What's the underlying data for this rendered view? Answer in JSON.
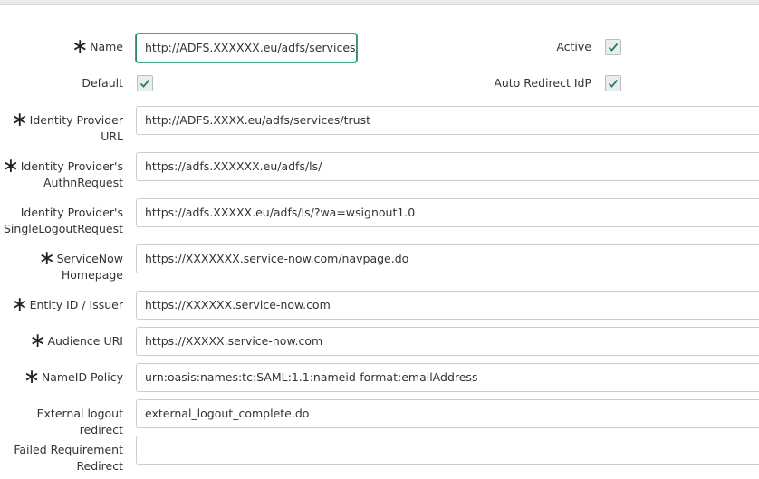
{
  "form": {
    "name": {
      "label": "Name",
      "value": "http://ADFS.XXXXXX.eu/adfs/services/trus"
    },
    "default": {
      "label": "Default",
      "checked": true
    },
    "active": {
      "label": "Active",
      "checked": true
    },
    "auto_redirect": {
      "label": "Auto Redirect IdP",
      "checked": true
    },
    "idp_url": {
      "label_line1": "Identity Provider",
      "label_line2": "URL",
      "value": "http://ADFS.XXXX.eu/adfs/services/trust"
    },
    "authn": {
      "label_line1": "Identity Provider's",
      "label_line2": "AuthnRequest",
      "value": "https://adfs.XXXXXX.eu/adfs/ls/"
    },
    "logout": {
      "label_line1": "Identity Provider's",
      "label_line2": "SingleLogoutRequest",
      "value": "https://adfs.XXXXX.eu/adfs/ls/?wa=wsignout1.0"
    },
    "homepage": {
      "label_line1": "ServiceNow",
      "label_line2": "Homepage",
      "value": "https://XXXXXXX.service-now.com/navpage.do"
    },
    "entity": {
      "label": "Entity ID / Issuer",
      "value": "https://XXXXXX.service-now.com"
    },
    "audience": {
      "label": "Audience URI",
      "value": "https://XXXXX.service-now.com"
    },
    "nameid": {
      "label": "NameID Policy",
      "value": "urn:oasis:names:tc:SAML:1.1:nameid-format:emailAddress"
    },
    "ext_logout": {
      "label": "External logout redirect",
      "value": "external_logout_complete.do"
    },
    "failed_req": {
      "label_line1": "Failed Requirement",
      "label_line2": "Redirect",
      "value": ""
    }
  },
  "required_marker": "∗",
  "colors": {
    "focus_border": "#2e8b77",
    "field_border": "#c9ced0",
    "checkbox_bg": "#e8eeee",
    "check_mark": "#2e7a6a"
  }
}
